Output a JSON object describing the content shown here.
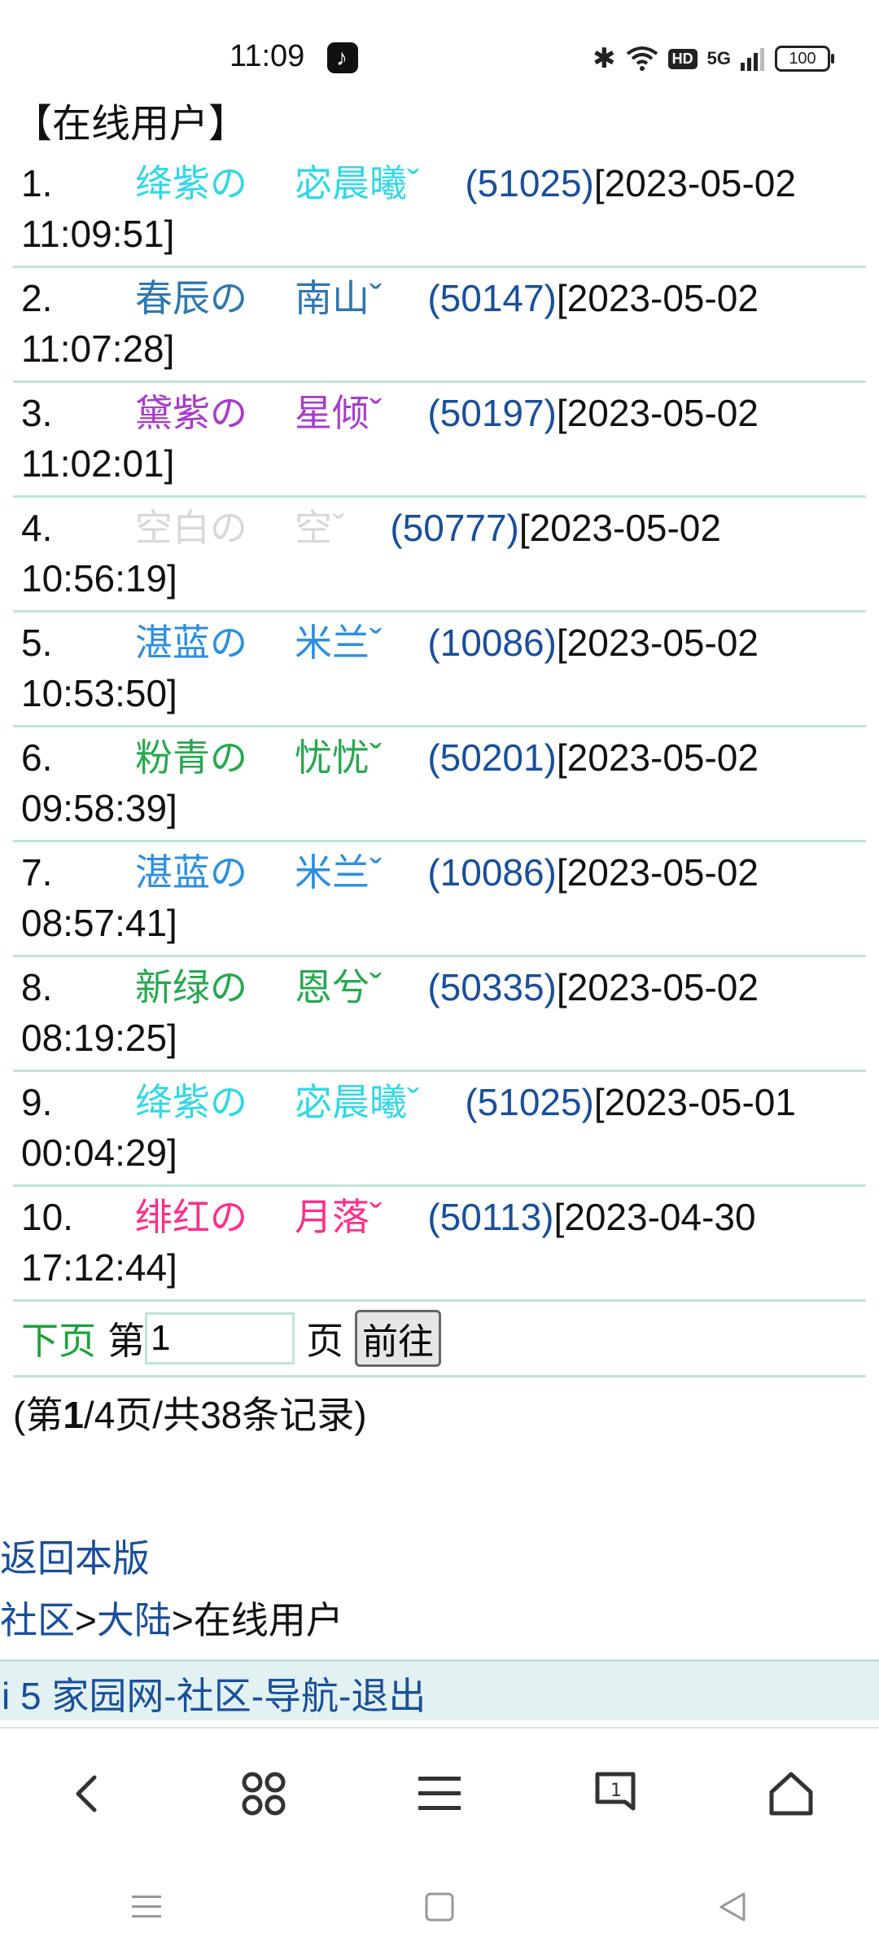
{
  "status": {
    "time": "11:09",
    "battery": "100",
    "hd": "HD",
    "network": "5G"
  },
  "page": {
    "title": "【在线用户】"
  },
  "users": [
    {
      "index": "1.",
      "nick1": "绛紫の",
      "nick2": "宓晨曦ˇ",
      "color": "#33d7e6",
      "uid": "(51025)",
      "date": "[2023-05-02",
      "time": "11:09:51]"
    },
    {
      "index": "2.",
      "nick1": "春辰の",
      "nick2": "南山ˇ",
      "color": "#2f77b0",
      "uid": "(50147)",
      "date": "[2023-05-02",
      "time": "11:07:28]"
    },
    {
      "index": "3.",
      "nick1": "黛紫の",
      "nick2": "星倾ˇ",
      "color": "#a83cc9",
      "uid": "(50197)",
      "date": "[2023-05-02",
      "time": "11:02:01]"
    },
    {
      "index": "4.",
      "nick1": "空白の",
      "nick2": "空ˇ",
      "color": "#d8d8d8",
      "uid": "(50777)",
      "date": "[2023-05-02",
      "time": "10:56:19]"
    },
    {
      "index": "5.",
      "nick1": "湛蓝の",
      "nick2": "米兰ˇ",
      "color": "#2c8fe0",
      "uid": "(10086)",
      "date": "[2023-05-02",
      "time": "10:53:50]"
    },
    {
      "index": "6.",
      "nick1": "粉青の",
      "nick2": "忧忧ˇ",
      "color": "#27a84f",
      "uid": "(50201)",
      "date": "[2023-05-02",
      "time": "09:58:39]"
    },
    {
      "index": "7.",
      "nick1": "湛蓝の",
      "nick2": "米兰ˇ",
      "color": "#2c8fe0",
      "uid": "(10086)",
      "date": "[2023-05-02",
      "time": "08:57:41]"
    },
    {
      "index": "8.",
      "nick1": "新绿の",
      "nick2": "恩兮ˇ",
      "color": "#27a84f",
      "uid": "(50335)",
      "date": "[2023-05-02",
      "time": "08:19:25]"
    },
    {
      "index": "9.",
      "nick1": "绛紫の",
      "nick2": "宓晨曦ˇ",
      "color": "#33d7e6",
      "uid": "(51025)",
      "date": "[2023-05-01",
      "time": "00:04:29]"
    },
    {
      "index": "10.",
      "nick1": "绯红の",
      "nick2": "月落ˇ",
      "color": "#ff2f8a",
      "uid": "(50113)",
      "date": "[2023-04-30",
      "time": "17:12:44]"
    }
  ],
  "pager": {
    "next_label": "下页",
    "page_prefix": "第",
    "page_value": "1",
    "page_suffix": "页",
    "go_label": "前往",
    "count_prefix": "(第",
    "count_current": "1",
    "count_suffix": "/4页/共38条记录)"
  },
  "links": {
    "back": "返回本版",
    "crumb1": "社区",
    "sep": ">",
    "crumb2": "大陆",
    "crumb3": "在线用户",
    "footer": [
      "i 5 家园网",
      "社区",
      "导航",
      "退出"
    ],
    "footer_sep": "-"
  }
}
